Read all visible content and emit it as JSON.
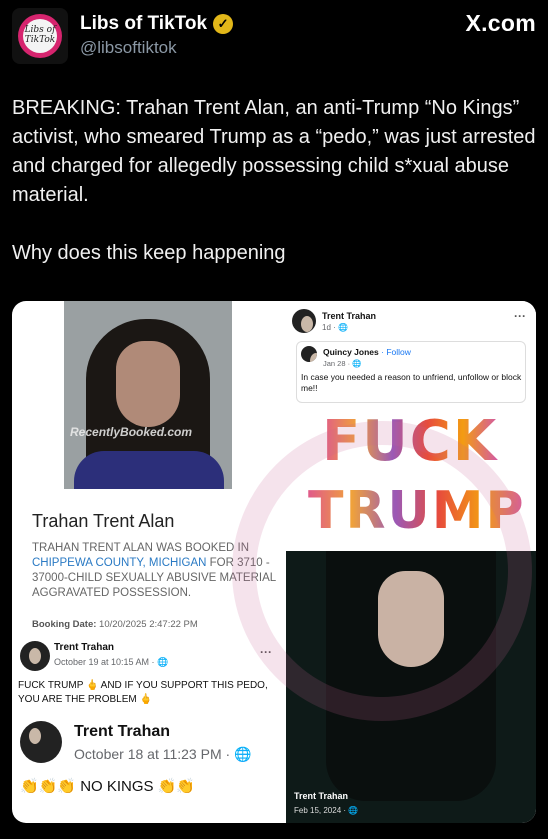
{
  "header": {
    "display_name": "Libs of TikTok",
    "handle": "@libsoftiktok",
    "brand": "X.com",
    "avatar_text": "Libs of TikTok",
    "verified_color": "#e2b719"
  },
  "tweet": {
    "paragraphs": [
      "BREAKING: Trahan Trent Alan, an anti-Trump “No Kings” activist, who smeared Trump as a “pedo,” was just arrested and charged for allegedly possessing child s*xual abuse material.",
      "Why does this keep happening"
    ]
  },
  "media": {
    "mugshot_watermark": "RecentlyBooked.com",
    "booking": {
      "name": "Trahan Trent Alan",
      "desc_before": "TRAHAN TRENT ALAN WAS BOOKED IN",
      "desc_link": "CHIPPEWA COUNTY, MICHIGAN",
      "desc_after": "FOR 3710 - 37000-CHILD SEXUALLY ABUSIVE MATERIAL AGGRAVATED POSSESSION.",
      "date_label": "Booking Date:",
      "date_value": "10/20/2025 2:47:22 PM"
    },
    "post1": {
      "name": "Trent Trahan",
      "time": "October 19 at 10:15 AM · ",
      "text": "FUCK TRUMP 🖕 AND IF YOU SUPPORT THIS PEDO, YOU ARE THE PROBLEM 🖕"
    },
    "post2": {
      "name": "Trent Trahan",
      "time": "October 18 at 11:23 PM · ",
      "text": "👏👏👏 NO KINGS 👏👏"
    },
    "right_post": {
      "name": "Trent Trahan",
      "time": "1d · ",
      "quote_name": "Quincy Jones",
      "quote_follow": "· Follow",
      "quote_time": "Jan 28 · ",
      "quote_text": "In case you needed a reason to unfriend, unfollow or block me!!",
      "flower_line1": "FUCK",
      "flower_line2": "TRUMP"
    },
    "photo_post": {
      "name": "Trent Trahan",
      "time": "Feb 15, 2024 · "
    }
  }
}
